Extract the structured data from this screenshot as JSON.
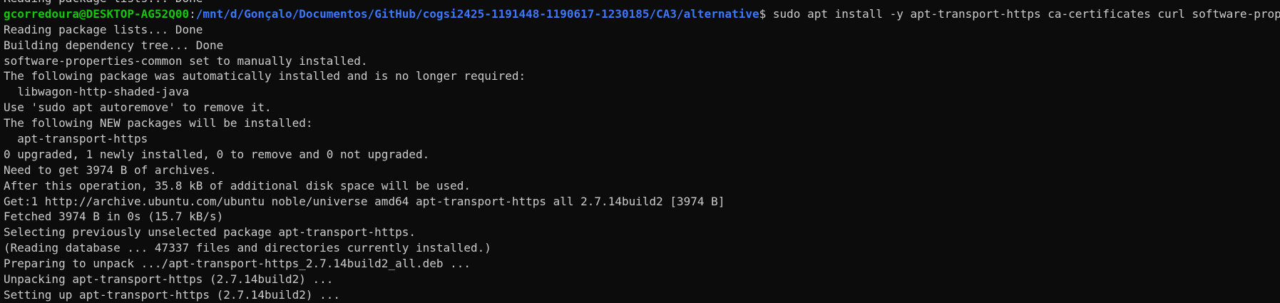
{
  "colors": {
    "background": "#0c0c0c",
    "foreground": "#cccccc",
    "prompt_user": "#16c60c",
    "prompt_path": "#3b78ff"
  },
  "partial_top_line": "Reading package lists... Done",
  "prompt": {
    "user_host": "gcorredoura@DESKTOP-AG52Q00",
    "separator": ":",
    "path": "/mnt/d/Gonçalo/Documentos/GitHub/cogsi2425-1191448-1190617-1230185/CA3/alternative",
    "symbol": "$",
    "command": " sudo apt install -y apt-transport-https ca-certificates curl software-properties-common"
  },
  "output": [
    "Reading package lists... Done",
    "Building dependency tree... Done",
    "software-properties-common set to manually installed.",
    "The following package was automatically installed and is no longer required:",
    "  libwagon-http-shaded-java",
    "Use 'sudo apt autoremove' to remove it.",
    "The following NEW packages will be installed:",
    "  apt-transport-https",
    "0 upgraded, 1 newly installed, 0 to remove and 0 not upgraded.",
    "Need to get 3974 B of archives.",
    "After this operation, 35.8 kB of additional disk space will be used.",
    "Get:1 http://archive.ubuntu.com/ubuntu noble/universe amd64 apt-transport-https all 2.7.14build2 [3974 B]",
    "Fetched 3974 B in 0s (15.7 kB/s)",
    "Selecting previously unselected package apt-transport-https.",
    "(Reading database ... 47337 files and directories currently installed.)",
    "Preparing to unpack .../apt-transport-https_2.7.14build2_all.deb ...",
    "Unpacking apt-transport-https (2.7.14build2) ...",
    "Setting up apt-transport-https (2.7.14build2) ..."
  ]
}
